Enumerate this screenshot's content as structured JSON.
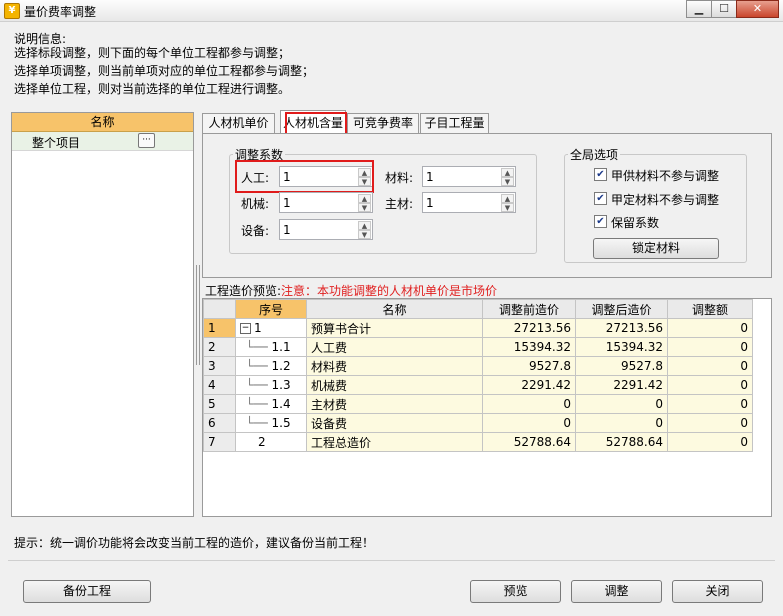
{
  "window": {
    "title": "量价费率调整",
    "min": "▁",
    "max": "☐",
    "close": "✕"
  },
  "info": {
    "label": "说明信息:",
    "lines": [
      "选择标段调整，则下面的每个单位工程都参与调整；",
      "选择单项调整，则当前单项对应的单位工程都参与调整；",
      "选择单位工程，则对当前选择的单位工程进行调整。"
    ]
  },
  "left_panel": {
    "header": "名称",
    "item": "整个项目",
    "more": "···"
  },
  "tabs": [
    "人材机单价",
    "人材机含量",
    "可竞争费率",
    "子目工程量"
  ],
  "adjust": {
    "group_label": "调整系数",
    "labor_label": "人工:",
    "labor_value": "1",
    "material_label": "材料:",
    "material_value": "1",
    "machine_label": "机械:",
    "machine_value": "1",
    "main_material_label": "主材:",
    "main_material_value": "1",
    "equipment_label": "设备:",
    "equipment_value": "1"
  },
  "global": {
    "group_label": "全局选项",
    "opt1": "甲供材料不参与调整",
    "opt2": "甲定材料不参与调整",
    "opt3": "保留系数",
    "lock_button": "锁定材料"
  },
  "preview": {
    "label": "工程造价预览:",
    "note": "注意：本功能调整的人材机单价是市场价"
  },
  "table": {
    "headers": [
      "序号",
      "名称",
      "调整前造价",
      "调整后造价",
      "调整额"
    ],
    "rows": [
      {
        "rn": "1",
        "seq": "1",
        "name": "预算书合计",
        "before": "27213.56",
        "after": "27213.56",
        "diff": "0"
      },
      {
        "rn": "2",
        "seq": "1.1",
        "name": "人工费",
        "before": "15394.32",
        "after": "15394.32",
        "diff": "0"
      },
      {
        "rn": "3",
        "seq": "1.2",
        "name": "材料费",
        "before": "9527.8",
        "after": "9527.8",
        "diff": "0"
      },
      {
        "rn": "4",
        "seq": "1.3",
        "name": "机械费",
        "before": "2291.42",
        "after": "2291.42",
        "diff": "0"
      },
      {
        "rn": "5",
        "seq": "1.4",
        "name": "主材费",
        "before": "0",
        "after": "0",
        "diff": "0"
      },
      {
        "rn": "6",
        "seq": "1.5",
        "name": "设备费",
        "before": "0",
        "after": "0",
        "diff": "0"
      },
      {
        "rn": "7",
        "seq": "2",
        "name": "工程总造价",
        "before": "52788.64",
        "after": "52788.64",
        "diff": "0"
      }
    ]
  },
  "hint": "提示：统一调价功能将会改变当前工程的造价，建议备份当前工程！",
  "buttons": {
    "backup": "备份工程",
    "preview": "预览",
    "adjust": "调整",
    "close": "关闭"
  }
}
